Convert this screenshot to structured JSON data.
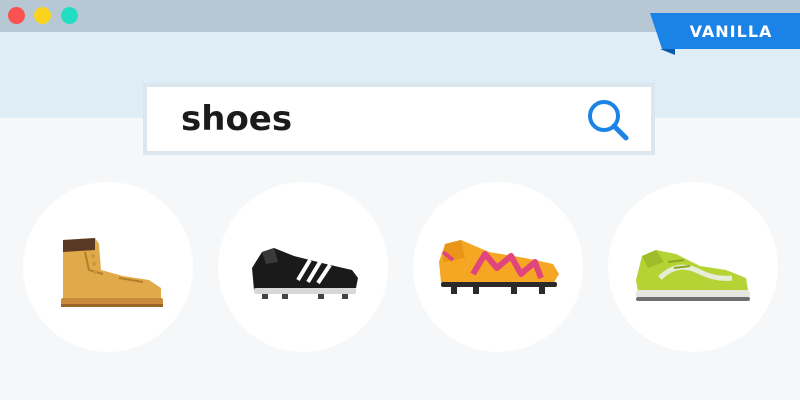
{
  "window": {
    "buttons": [
      "close",
      "minimize",
      "maximize"
    ],
    "button_colors": [
      "#fa5151",
      "#fbd31e",
      "#23ddc2"
    ]
  },
  "badge": {
    "label": "VANILLA",
    "color": "#1b83e6"
  },
  "search": {
    "value": "shoes",
    "icon": "search-icon",
    "accent": "#1b83e6"
  },
  "results": [
    {
      "icon": "work-boot-icon"
    },
    {
      "icon": "football-boot-black-icon"
    },
    {
      "icon": "football-boot-orange-icon"
    },
    {
      "icon": "sneaker-green-icon"
    }
  ]
}
